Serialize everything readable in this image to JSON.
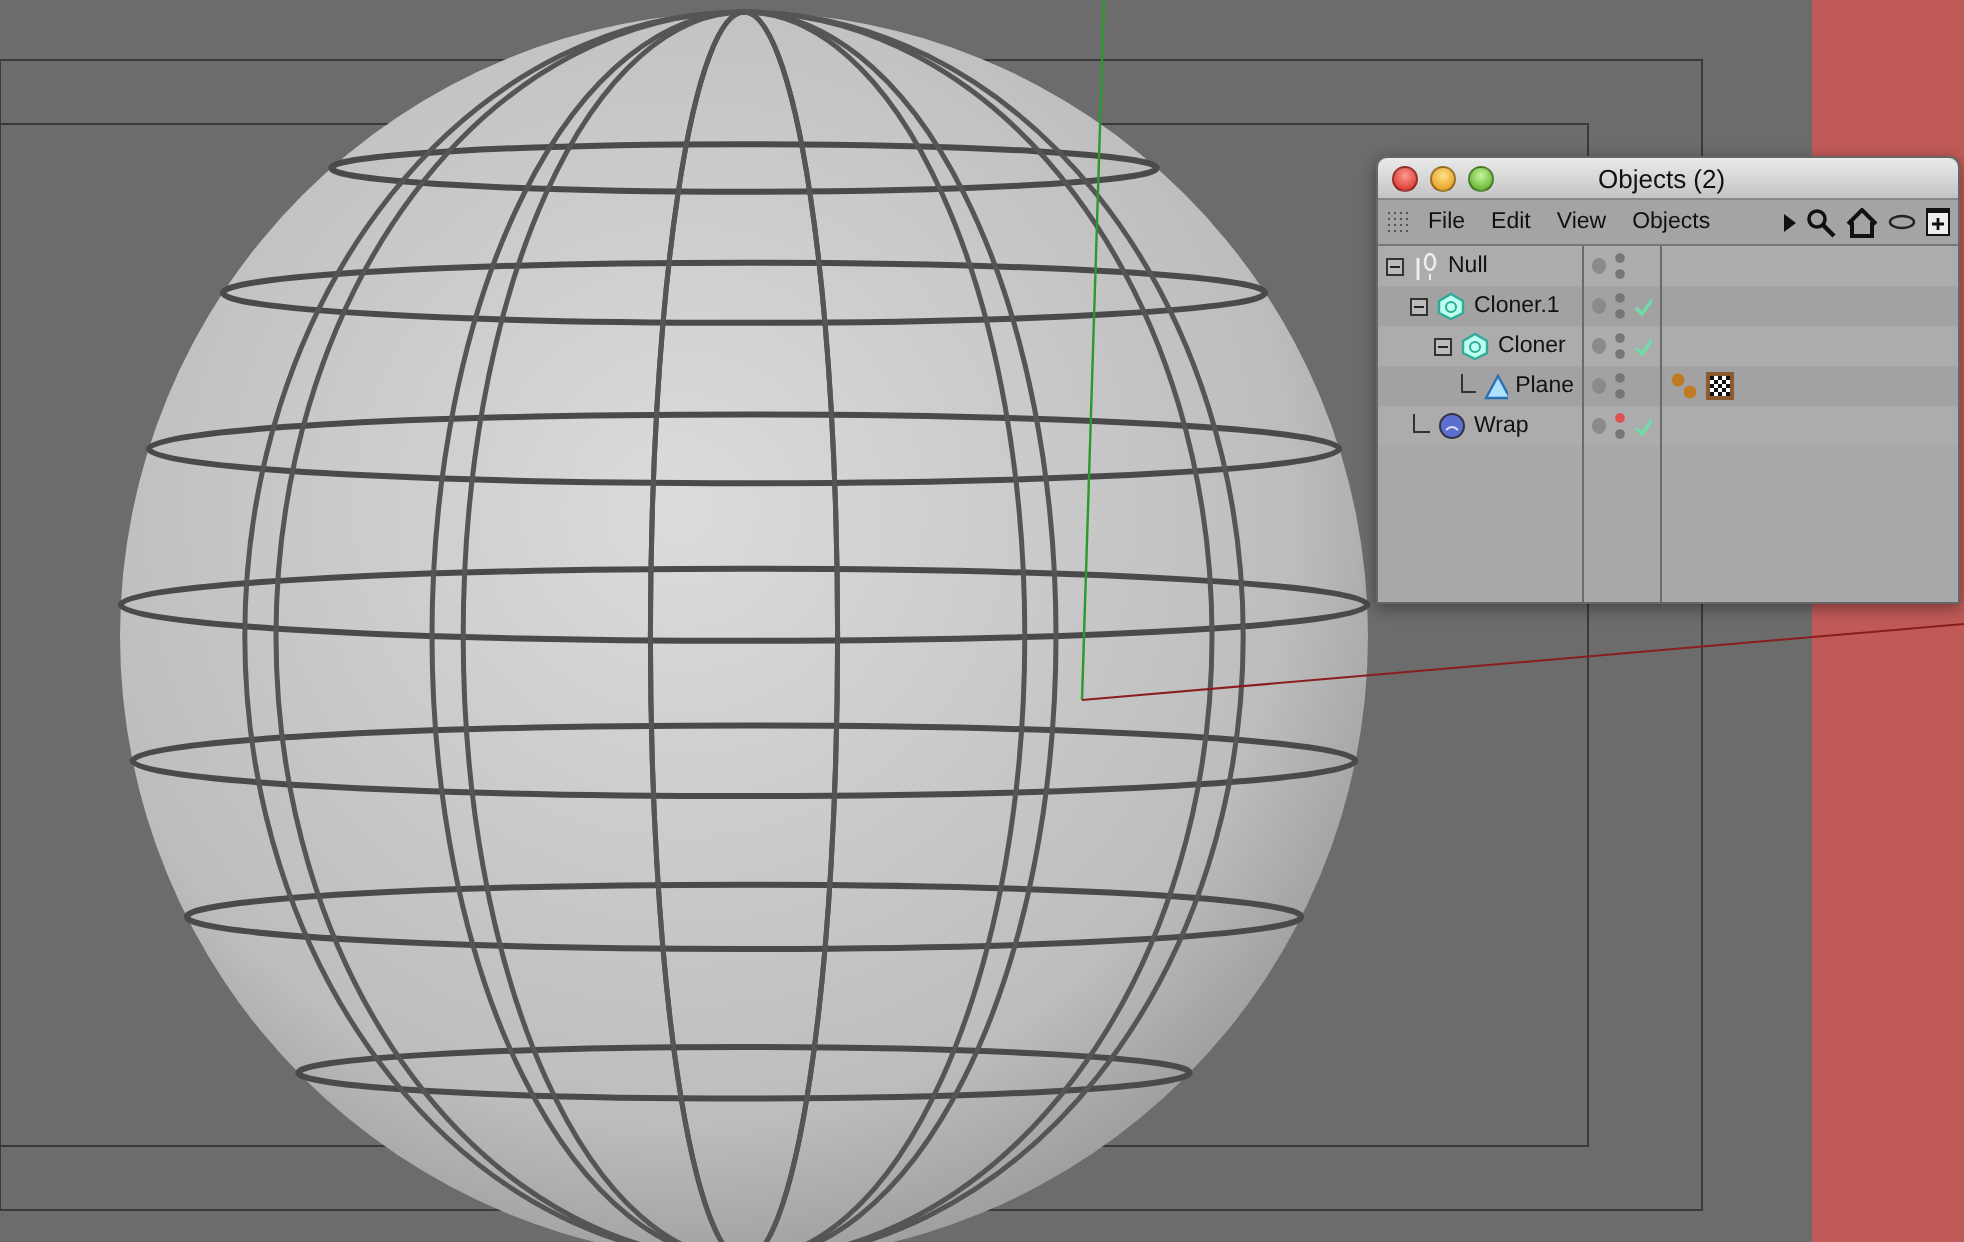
{
  "window": {
    "title": "Objects (2)"
  },
  "menu": [
    "File",
    "Edit",
    "View",
    "Objects"
  ],
  "tree": [
    {
      "name": "Null",
      "kind": "null",
      "expanded": true,
      "enabled": false,
      "editor_hidden": false,
      "children": [
        {
          "name": "Cloner.1",
          "kind": "cloner",
          "expanded": true,
          "enabled": true,
          "editor_hidden": false,
          "children": [
            {
              "name": "Cloner",
              "kind": "cloner",
              "expanded": true,
              "enabled": true,
              "editor_hidden": false,
              "children": [
                {
                  "name": "Plane",
                  "kind": "plane",
                  "enabled": false,
                  "editor_hidden": false,
                  "tags": [
                    {
                      "kind": "spheres"
                    },
                    {
                      "kind": "checker"
                    }
                  ]
                }
              ]
            }
          ]
        },
        {
          "name": "Wrap",
          "kind": "wrap",
          "enabled": true,
          "editor_hidden": true
        }
      ]
    }
  ]
}
